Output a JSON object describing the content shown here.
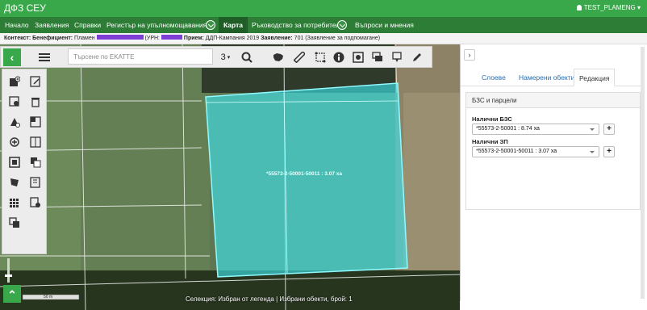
{
  "app": {
    "title": "ДФЗ СЕУ",
    "user": "TEST_PLAMENG"
  },
  "nav": {
    "items": [
      "Начало",
      "Заявления",
      "Справки",
      "Регистър на упълномощаванията",
      "Карта",
      "Ръководство за потребителя",
      "Въпроси и мнения"
    ],
    "active": "Карта"
  },
  "context": {
    "label": "Контекст:",
    "beneficiary_label": "Бенефициент:",
    "beneficiary": "Пламен",
    "urn_label": "(УРН:",
    "reception_label": "Прием:",
    "reception": "ДДП-Кампания 2019",
    "application_label": "Заявление:",
    "application": "701 (Заявление за подпомагане)"
  },
  "map": {
    "search_placeholder": "Търсене по EKATTE",
    "layer_count": "3",
    "parcel_label": "*55573-2-50001-50011 : 3.07 ха",
    "scale_label": "50 m",
    "status": "Селекция: Избран от легенда | Избрани обекти, брой: 1"
  },
  "panel": {
    "tabs": [
      "Слоеве",
      "Намерени обекти",
      "Редакция"
    ],
    "active_tab": "Редакция",
    "section_title": "БЗС и парцели",
    "bzs_label": "Налични БЗС",
    "bzs_value": "*55573-2-50001 : 8.74 ха",
    "zp_label": "Налични ЗП",
    "zp_value": "*55573-2-50001-50011 : 3.07 ха"
  },
  "colors": {
    "brand": "#39a84a",
    "nav": "#2d7d36",
    "parcel_fill": "#3fe6f0",
    "redaction": "#7e3fd6"
  }
}
